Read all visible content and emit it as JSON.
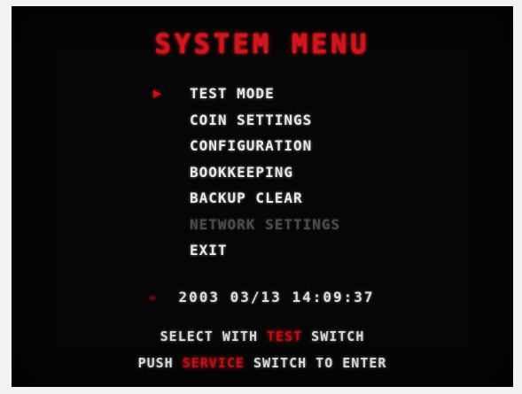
{
  "screen": {
    "title": "SYSTEM MENU",
    "cursor_symbol": "▶",
    "menu": [
      {
        "label": "TEST MODE",
        "selected": true,
        "enabled": true
      },
      {
        "label": "COIN SETTINGS",
        "selected": false,
        "enabled": true
      },
      {
        "label": "CONFIGURATION",
        "selected": false,
        "enabled": true
      },
      {
        "label": "BOOKKEEPING",
        "selected": false,
        "enabled": true
      },
      {
        "label": "BACKUP CLEAR",
        "selected": false,
        "enabled": true
      },
      {
        "label": "NETWORK SETTINGS",
        "selected": false,
        "enabled": false
      },
      {
        "label": "EXIT",
        "selected": false,
        "enabled": true
      }
    ],
    "clock": "2003 03/13 14:09:37",
    "instructions": {
      "line1_before": "SELECT WITH",
      "line1_key": "TEST",
      "line1_after": "SWITCH",
      "line2_before": "PUSH",
      "line2_key": "SERVICE",
      "line2_after": "SWITCH TO ENTER"
    }
  },
  "colors": {
    "background": "#060606",
    "title": "#d0151c",
    "menu_text": "#e8e8e8",
    "disabled_text": "#4c4c4c",
    "highlight_key": "#c5151c"
  }
}
